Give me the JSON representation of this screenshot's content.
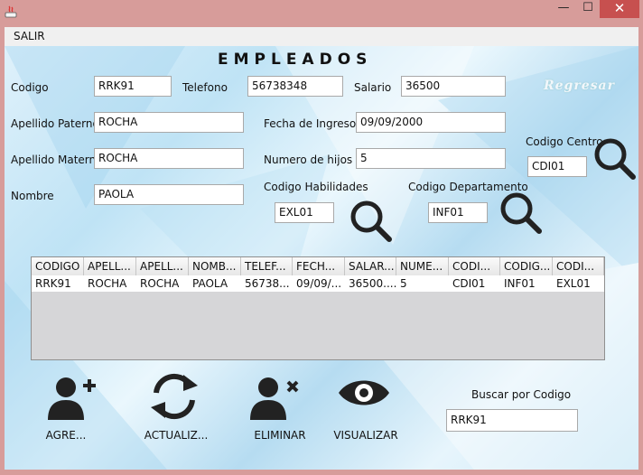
{
  "window": {
    "minimize": "—",
    "maximize": "☐",
    "close": "✕"
  },
  "menu": {
    "salir": "SALIR"
  },
  "title": "EMPLEADOS",
  "regresar": "Regresar",
  "form": {
    "codigo": {
      "label": "Codigo",
      "value": "RRK91"
    },
    "telefono": {
      "label": "Telefono",
      "value": "56738348"
    },
    "salario": {
      "label": "Salario",
      "value": "36500"
    },
    "apellido_paterno": {
      "label": "Apellido Paterno",
      "value": "ROCHA"
    },
    "fecha_ingreso": {
      "label": "Fecha de Ingreso",
      "value": "09/09/2000"
    },
    "codigo_centro": {
      "label": "Codigo Centro",
      "value": "CDI01"
    },
    "apellido_materno": {
      "label": "Apellido Materno",
      "value": "ROCHA"
    },
    "numero_hijos": {
      "label": "Numero de hijos",
      "value": "5"
    },
    "nombre": {
      "label": "Nombre",
      "value": "PAOLA"
    },
    "codigo_habilidades": {
      "label": "Codigo Habilidades",
      "value": "EXL01"
    },
    "codigo_departamento": {
      "label": "Codigo Departamento",
      "value": "INF01"
    }
  },
  "table": {
    "columns": [
      "CODIGO",
      "APELL...",
      "APELL...",
      "NOMB...",
      "TELEF...",
      "FECH...",
      "SALAR...",
      "NUME...",
      "CODI...",
      "CODIG...",
      "CODI..."
    ],
    "rows": [
      [
        "RRK91",
        "ROCHA",
        "ROCHA",
        "PAOLA",
        "56738...",
        "09/09/...",
        "36500....",
        "5",
        "CDI01",
        "INF01",
        "EXL01"
      ]
    ]
  },
  "actions": {
    "agregar": "AGRE...",
    "actualizar": "ACTUALIZ...",
    "eliminar": "ELIMINAR",
    "visualizar": "VISUALIZAR"
  },
  "buscar": {
    "label": "Buscar por Codigo",
    "value": "RRK91"
  },
  "colors": {
    "titlebar": "#d79c9a",
    "close": "#c7504f",
    "icon": "#222222"
  }
}
